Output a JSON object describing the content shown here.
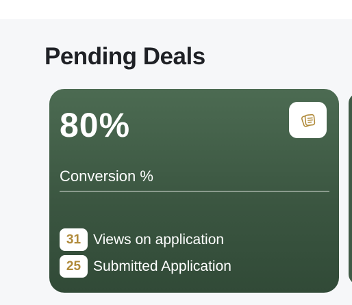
{
  "section": {
    "title": "Pending Deals"
  },
  "card": {
    "metric_value": "80%",
    "metric_label": "Conversion %",
    "icon": "documents-icon",
    "accent_color": "#b08a3a",
    "stats": [
      {
        "count": "31",
        "label": "Views on application"
      },
      {
        "count": "25",
        "label": "Submitted Application"
      }
    ]
  }
}
